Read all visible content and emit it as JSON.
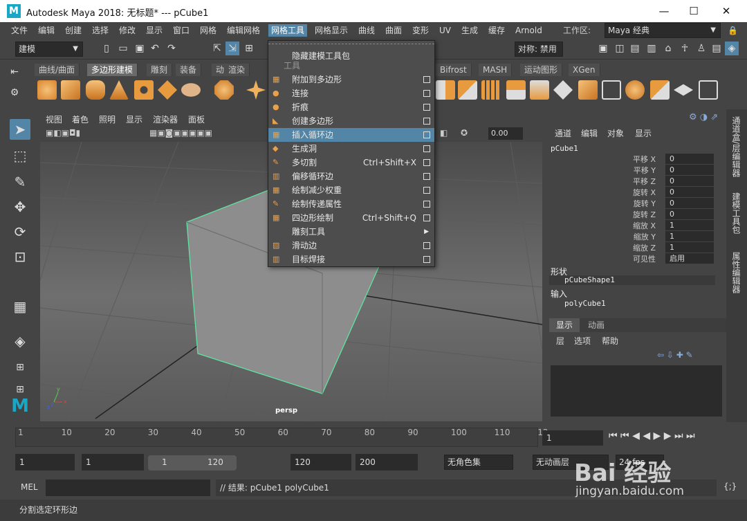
{
  "titlebar": {
    "title": "Autodesk Maya 2018: 无标题*   ---   pCube1"
  },
  "menubar": [
    "文件",
    "编辑",
    "创建",
    "选择",
    "修改",
    "显示",
    "窗口",
    "网格",
    "编辑网格",
    "网格工具",
    "网格显示",
    "曲线",
    "曲面",
    "变形",
    "UV",
    "生成",
    "缓存",
    "Arnold"
  ],
  "workspace": {
    "label": "工作区:",
    "value": "Maya 经典"
  },
  "statusline": {
    "mode": "建模",
    "symmetry": "对称: 禁用"
  },
  "shelf": {
    "tabs": [
      "曲线/曲面",
      "多边形建模",
      "雕刻",
      "装备",
      "动画",
      "渲染",
      "Bifrost",
      "MASH",
      "运动图形",
      "XGen"
    ]
  },
  "viewport": {
    "menus": [
      "视图",
      "着色",
      "照明",
      "显示",
      "渲染器",
      "面板"
    ],
    "field": "0.00",
    "camera": "persp",
    "axis_x": "x",
    "axis_y": "y",
    "axis_z": "z"
  },
  "menu": {
    "top_item": "隐藏建模工具包",
    "section": "工具",
    "items": [
      {
        "label": "附加到多边形",
        "shortcut": "",
        "has_box": true,
        "icon": "▦"
      },
      {
        "label": "连接",
        "shortcut": "",
        "has_box": true,
        "icon": "●"
      },
      {
        "label": "折痕",
        "shortcut": "",
        "has_box": true,
        "icon": "●"
      },
      {
        "label": "创建多边形",
        "shortcut": "",
        "has_box": true,
        "icon": "◣"
      },
      {
        "label": "插入循环边",
        "shortcut": "",
        "has_box": true,
        "icon": "▦",
        "highlighted": true
      },
      {
        "label": "生成洞",
        "shortcut": "",
        "has_box": true,
        "icon": "◆"
      },
      {
        "label": "多切割",
        "shortcut": "Ctrl+Shift+X",
        "has_box": true,
        "icon": "✎"
      },
      {
        "label": "偏移循环边",
        "shortcut": "",
        "has_box": true,
        "icon": "▥"
      },
      {
        "label": "绘制减少权重",
        "shortcut": "",
        "has_box": true,
        "icon": "▦"
      },
      {
        "label": "绘制传递属性",
        "shortcut": "",
        "has_box": true,
        "icon": "✎"
      },
      {
        "label": "四边形绘制",
        "shortcut": "Ctrl+Shift+Q",
        "has_box": true,
        "icon": "▦"
      },
      {
        "label": "雕刻工具",
        "shortcut": "",
        "has_box": false,
        "submenu": true,
        "icon": ""
      },
      {
        "label": "滑动边",
        "shortcut": "",
        "has_box": true,
        "icon": "▨"
      },
      {
        "label": "目标焊接",
        "shortcut": "",
        "has_box": true,
        "icon": "▥"
      }
    ]
  },
  "channelbox": {
    "menus": [
      "通道",
      "编辑",
      "对象",
      "显示"
    ],
    "object": "pCube1",
    "rows": [
      {
        "k": "平移 X",
        "v": "0"
      },
      {
        "k": "平移 Y",
        "v": "0"
      },
      {
        "k": "平移 Z",
        "v": "0"
      },
      {
        "k": "旋转 X",
        "v": "0"
      },
      {
        "k": "旋转 Y",
        "v": "0"
      },
      {
        "k": "旋转 Z",
        "v": "0"
      },
      {
        "k": "缩放 X",
        "v": "1"
      },
      {
        "k": "缩放 Y",
        "v": "1"
      },
      {
        "k": "缩放 Z",
        "v": "1"
      },
      {
        "k": "可见性",
        "v": "启用"
      }
    ],
    "shapes_label": "形状",
    "shape": "pCubeShape1",
    "inputs_label": "输入",
    "input": "polyCube1",
    "layer_tabs": [
      "显示",
      "动画"
    ],
    "layer_menus": [
      "层",
      "选项",
      "帮助"
    ]
  },
  "sidetabs": [
    "通道盒/层编辑器",
    "建模工具包",
    "属性编辑器"
  ],
  "timeslider": {
    "ticks": [
      "1",
      "10",
      "20",
      "30",
      "40",
      "50",
      "60",
      "70",
      "80",
      "90",
      "100",
      "110",
      "12"
    ],
    "current": "1"
  },
  "range": {
    "start": "1",
    "inner_start": "1",
    "slider_start": "1",
    "slider_end": "120",
    "inner_end": "120",
    "end": "200",
    "charset": "无角色集",
    "animlayer": "无动画层",
    "fps": "24 fps"
  },
  "cmd": {
    "lang": "MEL",
    "result": "// 结果: pCube1 polyCube1"
  },
  "help": {
    "text": "分割选定环形边"
  },
  "watermark": {
    "text": "Bai 经验",
    "url": "jingyan.baidu.com"
  }
}
